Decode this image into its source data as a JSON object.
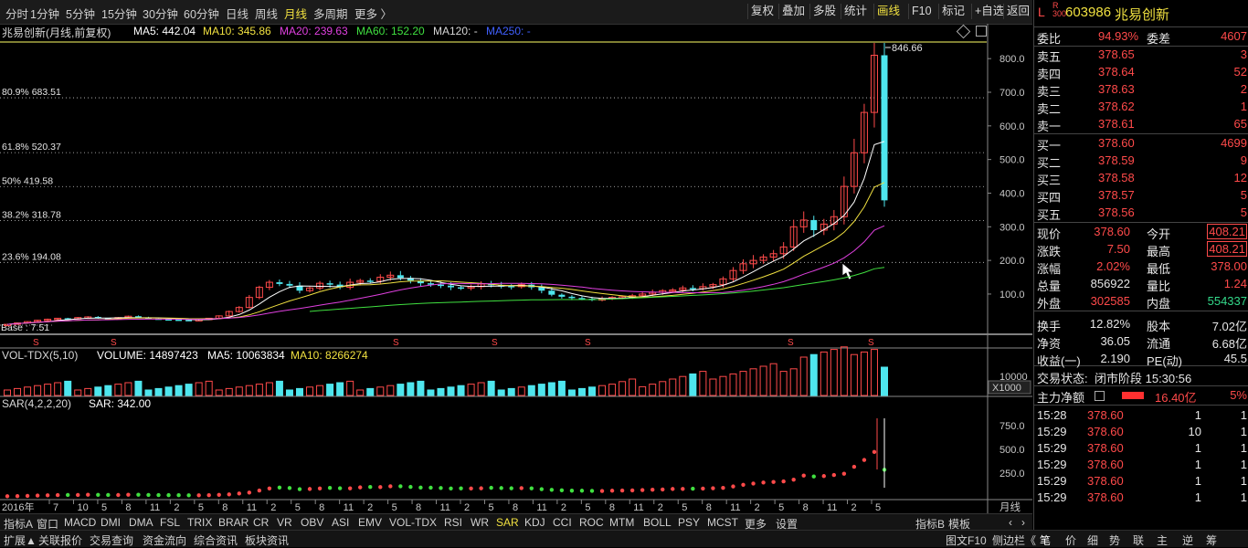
{
  "toolbar": {
    "periods": [
      "分时",
      "1分钟",
      "5分钟",
      "15分钟",
      "30分钟",
      "60分钟",
      "日线",
      "周线",
      "月线",
      "多周期",
      "更多 〉"
    ],
    "active_period": "月线",
    "buttons": [
      "复权",
      "叠加",
      "多股",
      "统计",
      "画线",
      "F10",
      "标记",
      "+自选",
      "返回"
    ]
  },
  "ma_line": {
    "title": "兆易创新(月线,前复权)",
    "ma5": "MA5: 442.04",
    "ma10": "MA10: 345.86",
    "ma20": "MA20: 239.63",
    "ma60": "MA60: 152.20",
    "ma120": "MA120: -",
    "ma250": "MA250: -"
  },
  "colors": {
    "ma5": "#ffffff",
    "ma10": "#f0e040",
    "ma20": "#e040e0",
    "ma60": "#40e040",
    "ma250": "#4060ff",
    "up": "#ff4a4a",
    "down": "#4ee6ee"
  },
  "main_chart": {
    "y_ticks": [
      "800.0",
      "700.0",
      "600.0",
      "500.0",
      "400.0",
      "300.0",
      "200.0",
      "100.0"
    ],
    "high_label": "846.66",
    "base_label": "Base : 7.51",
    "fib_lines": [
      {
        "label": "80.9% 683.51",
        "value": 683.51
      },
      {
        "label": "61.8% 520.37",
        "value": 520.37
      },
      {
        "label": "50% 419.58",
        "value": 419.58
      },
      {
        "label": "38.2% 318.78",
        "value": 318.78
      },
      {
        "label": "23.6% 194.08",
        "value": 194.08
      }
    ]
  },
  "vol": {
    "title": "VOL-TDX(5,10)",
    "volume": "VOLUME: 14897423",
    "ma5": "MA5: 10063834",
    "ma10": "MA10: 8266274",
    "tick": "10000",
    "unit": "X1000"
  },
  "sar": {
    "title": "SAR(4,2,2,20)",
    "value": "SAR: 342.00",
    "ticks": [
      "750.0",
      "500.0",
      "250.0"
    ]
  },
  "time_axis": {
    "year": "2016年",
    "months": [
      "7",
      "10",
      "5",
      "8",
      "11",
      "2",
      "5",
      "8",
      "11",
      "2",
      "5",
      "8",
      "11",
      "2",
      "5",
      "8",
      "11",
      "2",
      "5",
      "8",
      "11",
      "2",
      "5",
      "8",
      "11",
      "2",
      "5",
      "8",
      "11",
      "2",
      "5",
      "8",
      "11",
      "2",
      "5"
    ],
    "period_label": "月线"
  },
  "indicator_tabs": [
    "指标A",
    "窗口",
    "MACD",
    "DMI",
    "DMA",
    "FSL",
    "TRIX",
    "BRAR",
    "CR",
    "VR",
    "OBV",
    "ASI",
    "EMV",
    "VOL-TDX",
    "RSI",
    "WR",
    "SAR",
    "KDJ",
    "CCI",
    "ROC",
    "MTM",
    "BOLL",
    "PSY",
    "MCST",
    "更多",
    "设置"
  ],
  "active_indicator": "SAR",
  "right_tabs": [
    "指标B",
    "模板"
  ],
  "bottom_left": [
    "扩展▲",
    "关联报价",
    "交易查询",
    "资金流向",
    "综合资讯",
    "板块资讯"
  ],
  "bottom_right": [
    "图文F10",
    "侧边栏《",
    "笔",
    "价",
    "细",
    "势",
    "联",
    "主",
    "逆",
    "筹"
  ],
  "quote": {
    "code": "603986",
    "name": "兆易创新",
    "webi_label": "委比",
    "webi": "94.93%",
    "wecha_label": "委差",
    "wecha": "4607",
    "asks": [
      {
        "label": "卖五",
        "price": "378.65",
        "vol": "3"
      },
      {
        "label": "卖四",
        "price": "378.64",
        "vol": "52"
      },
      {
        "label": "卖三",
        "price": "378.63",
        "vol": "2"
      },
      {
        "label": "卖二",
        "price": "378.62",
        "vol": "1"
      },
      {
        "label": "卖一",
        "price": "378.61",
        "vol": "65"
      }
    ],
    "bids": [
      {
        "label": "买一",
        "price": "378.60",
        "vol": "4699"
      },
      {
        "label": "买二",
        "price": "378.59",
        "vol": "9"
      },
      {
        "label": "买三",
        "price": "378.58",
        "vol": "12"
      },
      {
        "label": "买四",
        "price": "378.57",
        "vol": "5"
      },
      {
        "label": "买五",
        "price": "378.56",
        "vol": "5"
      }
    ],
    "stats": [
      {
        "l1": "现价",
        "v1": "378.60",
        "c1": "red",
        "l2": "今开",
        "v2": "408.21",
        "c2": "red",
        "box": true
      },
      {
        "l1": "涨跌",
        "v1": "7.50",
        "c1": "red",
        "l2": "最高",
        "v2": "408.21",
        "c2": "red",
        "box": true
      },
      {
        "l1": "涨幅",
        "v1": "2.02%",
        "c1": "red",
        "l2": "最低",
        "v2": "378.00",
        "c2": "red"
      },
      {
        "l1": "总量",
        "v1": "856922",
        "c1": "wht",
        "l2": "量比",
        "v2": "1.24",
        "c2": "red"
      },
      {
        "l1": "外盘",
        "v1": "302585",
        "c1": "red",
        "l2": "内盘",
        "v2": "554337",
        "c2": "grn"
      },
      {
        "l1": "换手",
        "v1": "12.82%",
        "c1": "wht",
        "l2": "股本",
        "v2": "7.02亿",
        "c2": "wht"
      },
      {
        "l1": "净资",
        "v1": "36.05",
        "c1": "wht",
        "l2": "流通",
        "v2": "6.68亿",
        "c2": "wht"
      },
      {
        "l1": "收益(一)",
        "v1": "2.190",
        "c1": "wht",
        "l2": "PE(动)",
        "v2": "45.5",
        "c2": "wht"
      }
    ],
    "status_label": "交易状态:",
    "status": "闭市阶段 15:30:56",
    "flow_label": "主力净额",
    "flow_value": "16.40亿",
    "flow_pct": "5%",
    "ticks": [
      {
        "t": "15:28",
        "p": "378.60",
        "v": "1",
        "n": "1"
      },
      {
        "t": "15:29",
        "p": "378.60",
        "v": "10",
        "n": "1"
      },
      {
        "t": "15:29",
        "p": "378.60",
        "v": "1",
        "n": "1"
      },
      {
        "t": "15:29",
        "p": "378.60",
        "v": "1",
        "n": "1"
      },
      {
        "t": "15:29",
        "p": "378.60",
        "v": "1",
        "n": "1"
      },
      {
        "t": "15:29",
        "p": "378.60",
        "v": "1",
        "n": "1"
      }
    ]
  }
}
